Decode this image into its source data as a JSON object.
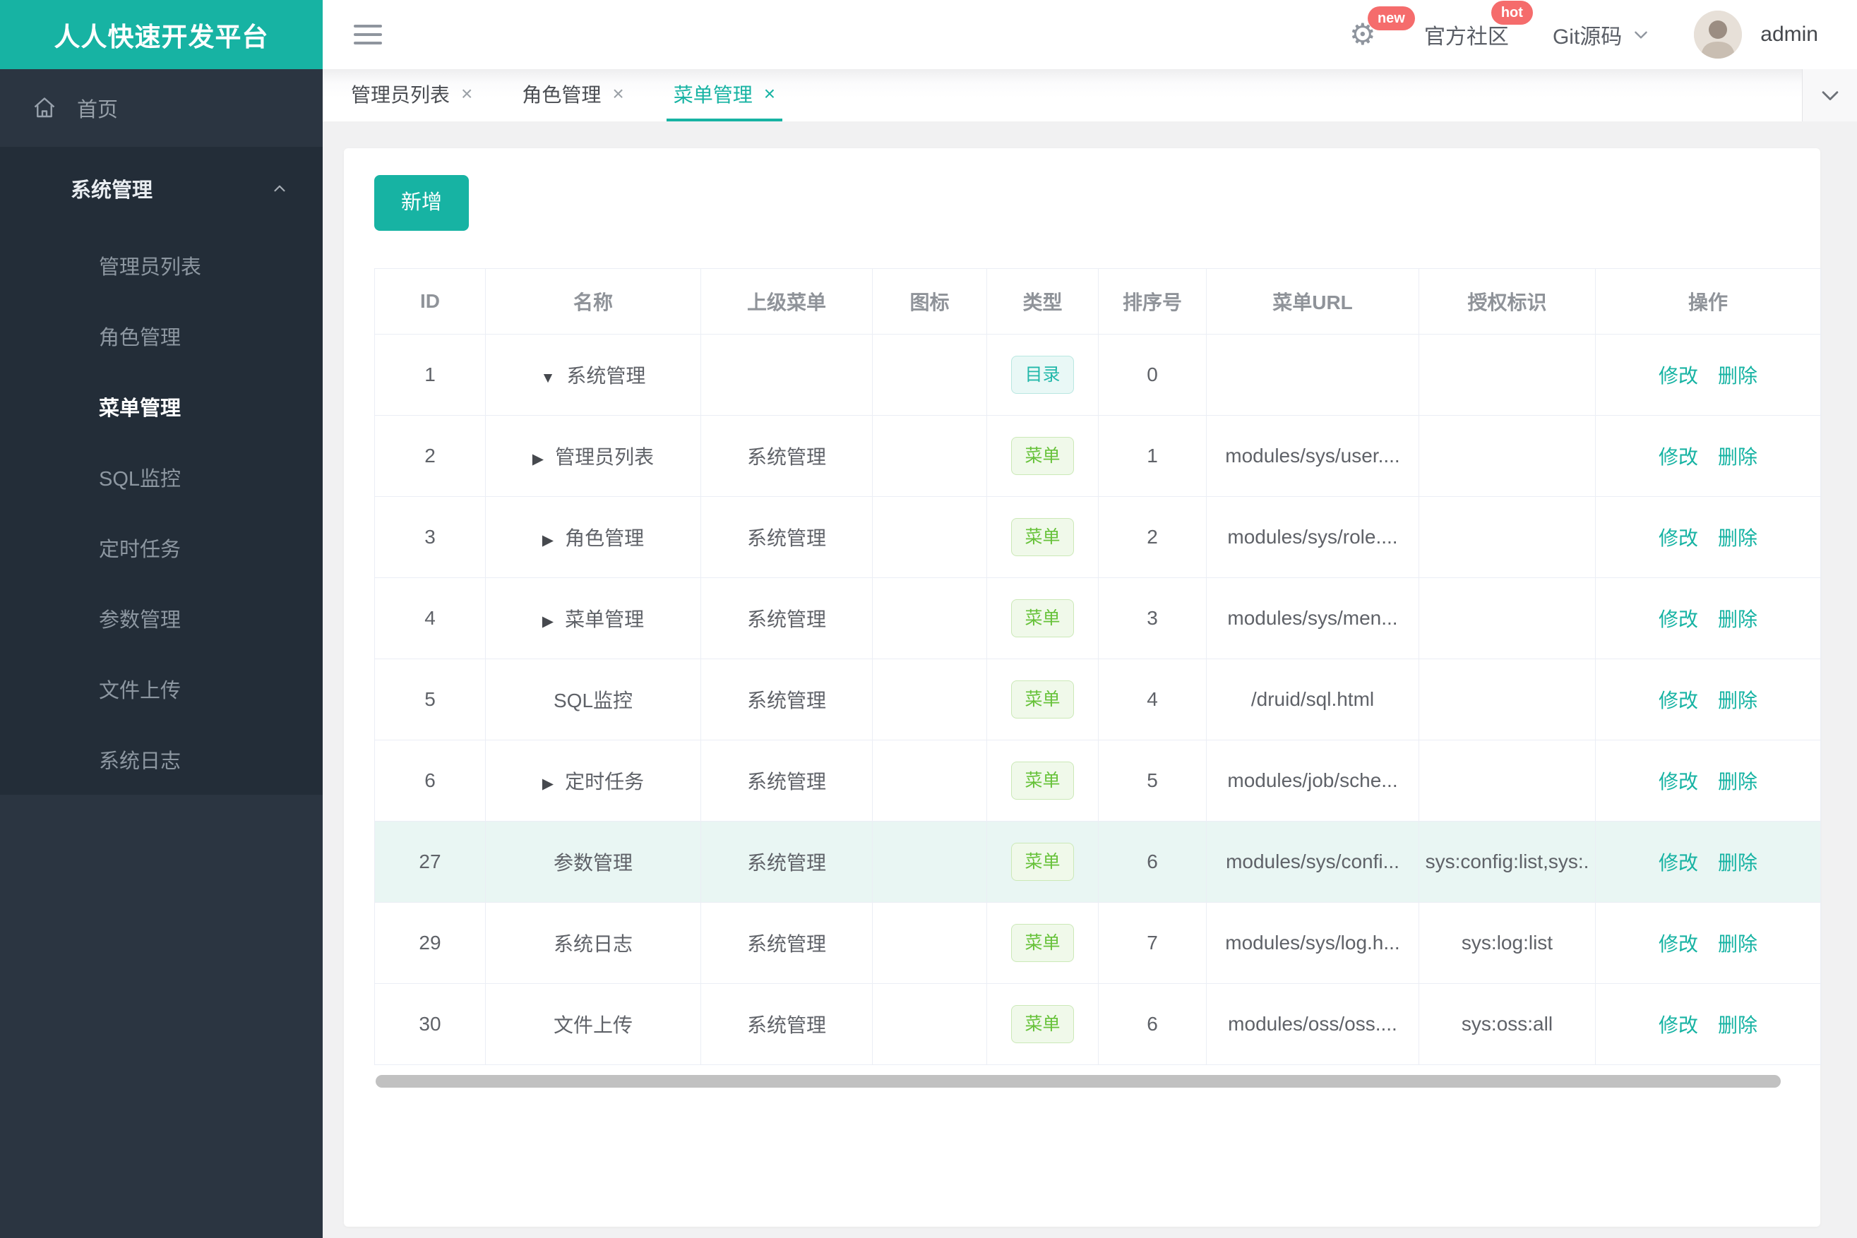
{
  "app": {
    "title": "人人快速开发平台",
    "username": "admin"
  },
  "header": {
    "community_label": "官方社区",
    "git_label": "Git源码",
    "badge_new": "new",
    "badge_hot": "hot",
    "icons": [
      "gear-icon",
      "chevron-down-icon",
      "hamburger-icon",
      "user-avatar"
    ]
  },
  "sidebar": {
    "home_label": "首页",
    "group_label": "系统管理",
    "active": "菜单管理",
    "items": [
      {
        "key": "admin-list",
        "label": "管理员列表"
      },
      {
        "key": "role-management",
        "label": "角色管理"
      },
      {
        "key": "menu-management",
        "label": "菜单管理"
      },
      {
        "key": "sql-monitor",
        "label": "SQL监控"
      },
      {
        "key": "scheduled-tasks",
        "label": "定时任务"
      },
      {
        "key": "param-management",
        "label": "参数管理"
      },
      {
        "key": "file-upload",
        "label": "文件上传"
      },
      {
        "key": "system-log",
        "label": "系统日志"
      }
    ]
  },
  "tabs": [
    {
      "key": "admin-list",
      "label": "管理员列表",
      "active": false
    },
    {
      "key": "role-management",
      "label": "角色管理",
      "active": false
    },
    {
      "key": "menu-management",
      "label": "菜单管理",
      "active": true
    }
  ],
  "tab_close_glyph": "×",
  "toolbar": {
    "add_label": "新增"
  },
  "table": {
    "columns": [
      "ID",
      "名称",
      "上级菜单",
      "图标",
      "类型",
      "排序号",
      "菜单URL",
      "授权标识",
      "操作"
    ],
    "tag_labels": {
      "dir": "目录",
      "menu": "菜单"
    },
    "arrow_glyphs": {
      "down": "▼",
      "right": "▶",
      "none": ""
    },
    "actions": {
      "edit": "修改",
      "delete": "删除"
    },
    "rows": [
      {
        "id": "1",
        "arrow": "down",
        "name": "系统管理",
        "parent": "",
        "icon": "",
        "type": "dir",
        "order": "0",
        "url": "",
        "perms": "",
        "highlight": false
      },
      {
        "id": "2",
        "arrow": "right",
        "name": "管理员列表",
        "parent": "系统管理",
        "icon": "",
        "type": "menu",
        "order": "1",
        "url": "modules/sys/user....",
        "perms": "",
        "highlight": false
      },
      {
        "id": "3",
        "arrow": "right",
        "name": "角色管理",
        "parent": "系统管理",
        "icon": "",
        "type": "menu",
        "order": "2",
        "url": "modules/sys/role....",
        "perms": "",
        "highlight": false
      },
      {
        "id": "4",
        "arrow": "right",
        "name": "菜单管理",
        "parent": "系统管理",
        "icon": "",
        "type": "menu",
        "order": "3",
        "url": "modules/sys/men...",
        "perms": "",
        "highlight": false
      },
      {
        "id": "5",
        "arrow": "none",
        "name": "SQL监控",
        "parent": "系统管理",
        "icon": "",
        "type": "menu",
        "order": "4",
        "url": "/druid/sql.html",
        "perms": "",
        "highlight": false
      },
      {
        "id": "6",
        "arrow": "right",
        "name": "定时任务",
        "parent": "系统管理",
        "icon": "",
        "type": "menu",
        "order": "5",
        "url": "modules/job/sche...",
        "perms": "",
        "highlight": false
      },
      {
        "id": "27",
        "arrow": "none",
        "name": "参数管理",
        "parent": "系统管理",
        "icon": "",
        "type": "menu",
        "order": "6",
        "url": "modules/sys/confi...",
        "perms": "sys:config:list,sys:.",
        "highlight": true
      },
      {
        "id": "29",
        "arrow": "none",
        "name": "系统日志",
        "parent": "系统管理",
        "icon": "",
        "type": "menu",
        "order": "7",
        "url": "modules/sys/log.h...",
        "perms": "sys:log:list",
        "highlight": false
      },
      {
        "id": "30",
        "arrow": "none",
        "name": "文件上传",
        "parent": "系统管理",
        "icon": "",
        "type": "menu",
        "order": "6",
        "url": "modules/oss/oss....",
        "perms": "sys:oss:all",
        "highlight": false
      }
    ]
  },
  "colors": {
    "accent": "#17b3a3",
    "badge": "#f56c6c",
    "sidebar_bg": "#2b3541",
    "sidebar_group_bg": "#232d38",
    "row_highlight": "#e9f6f3",
    "tag_dir": "#23b8aa",
    "tag_menu": "#67c23a"
  }
}
